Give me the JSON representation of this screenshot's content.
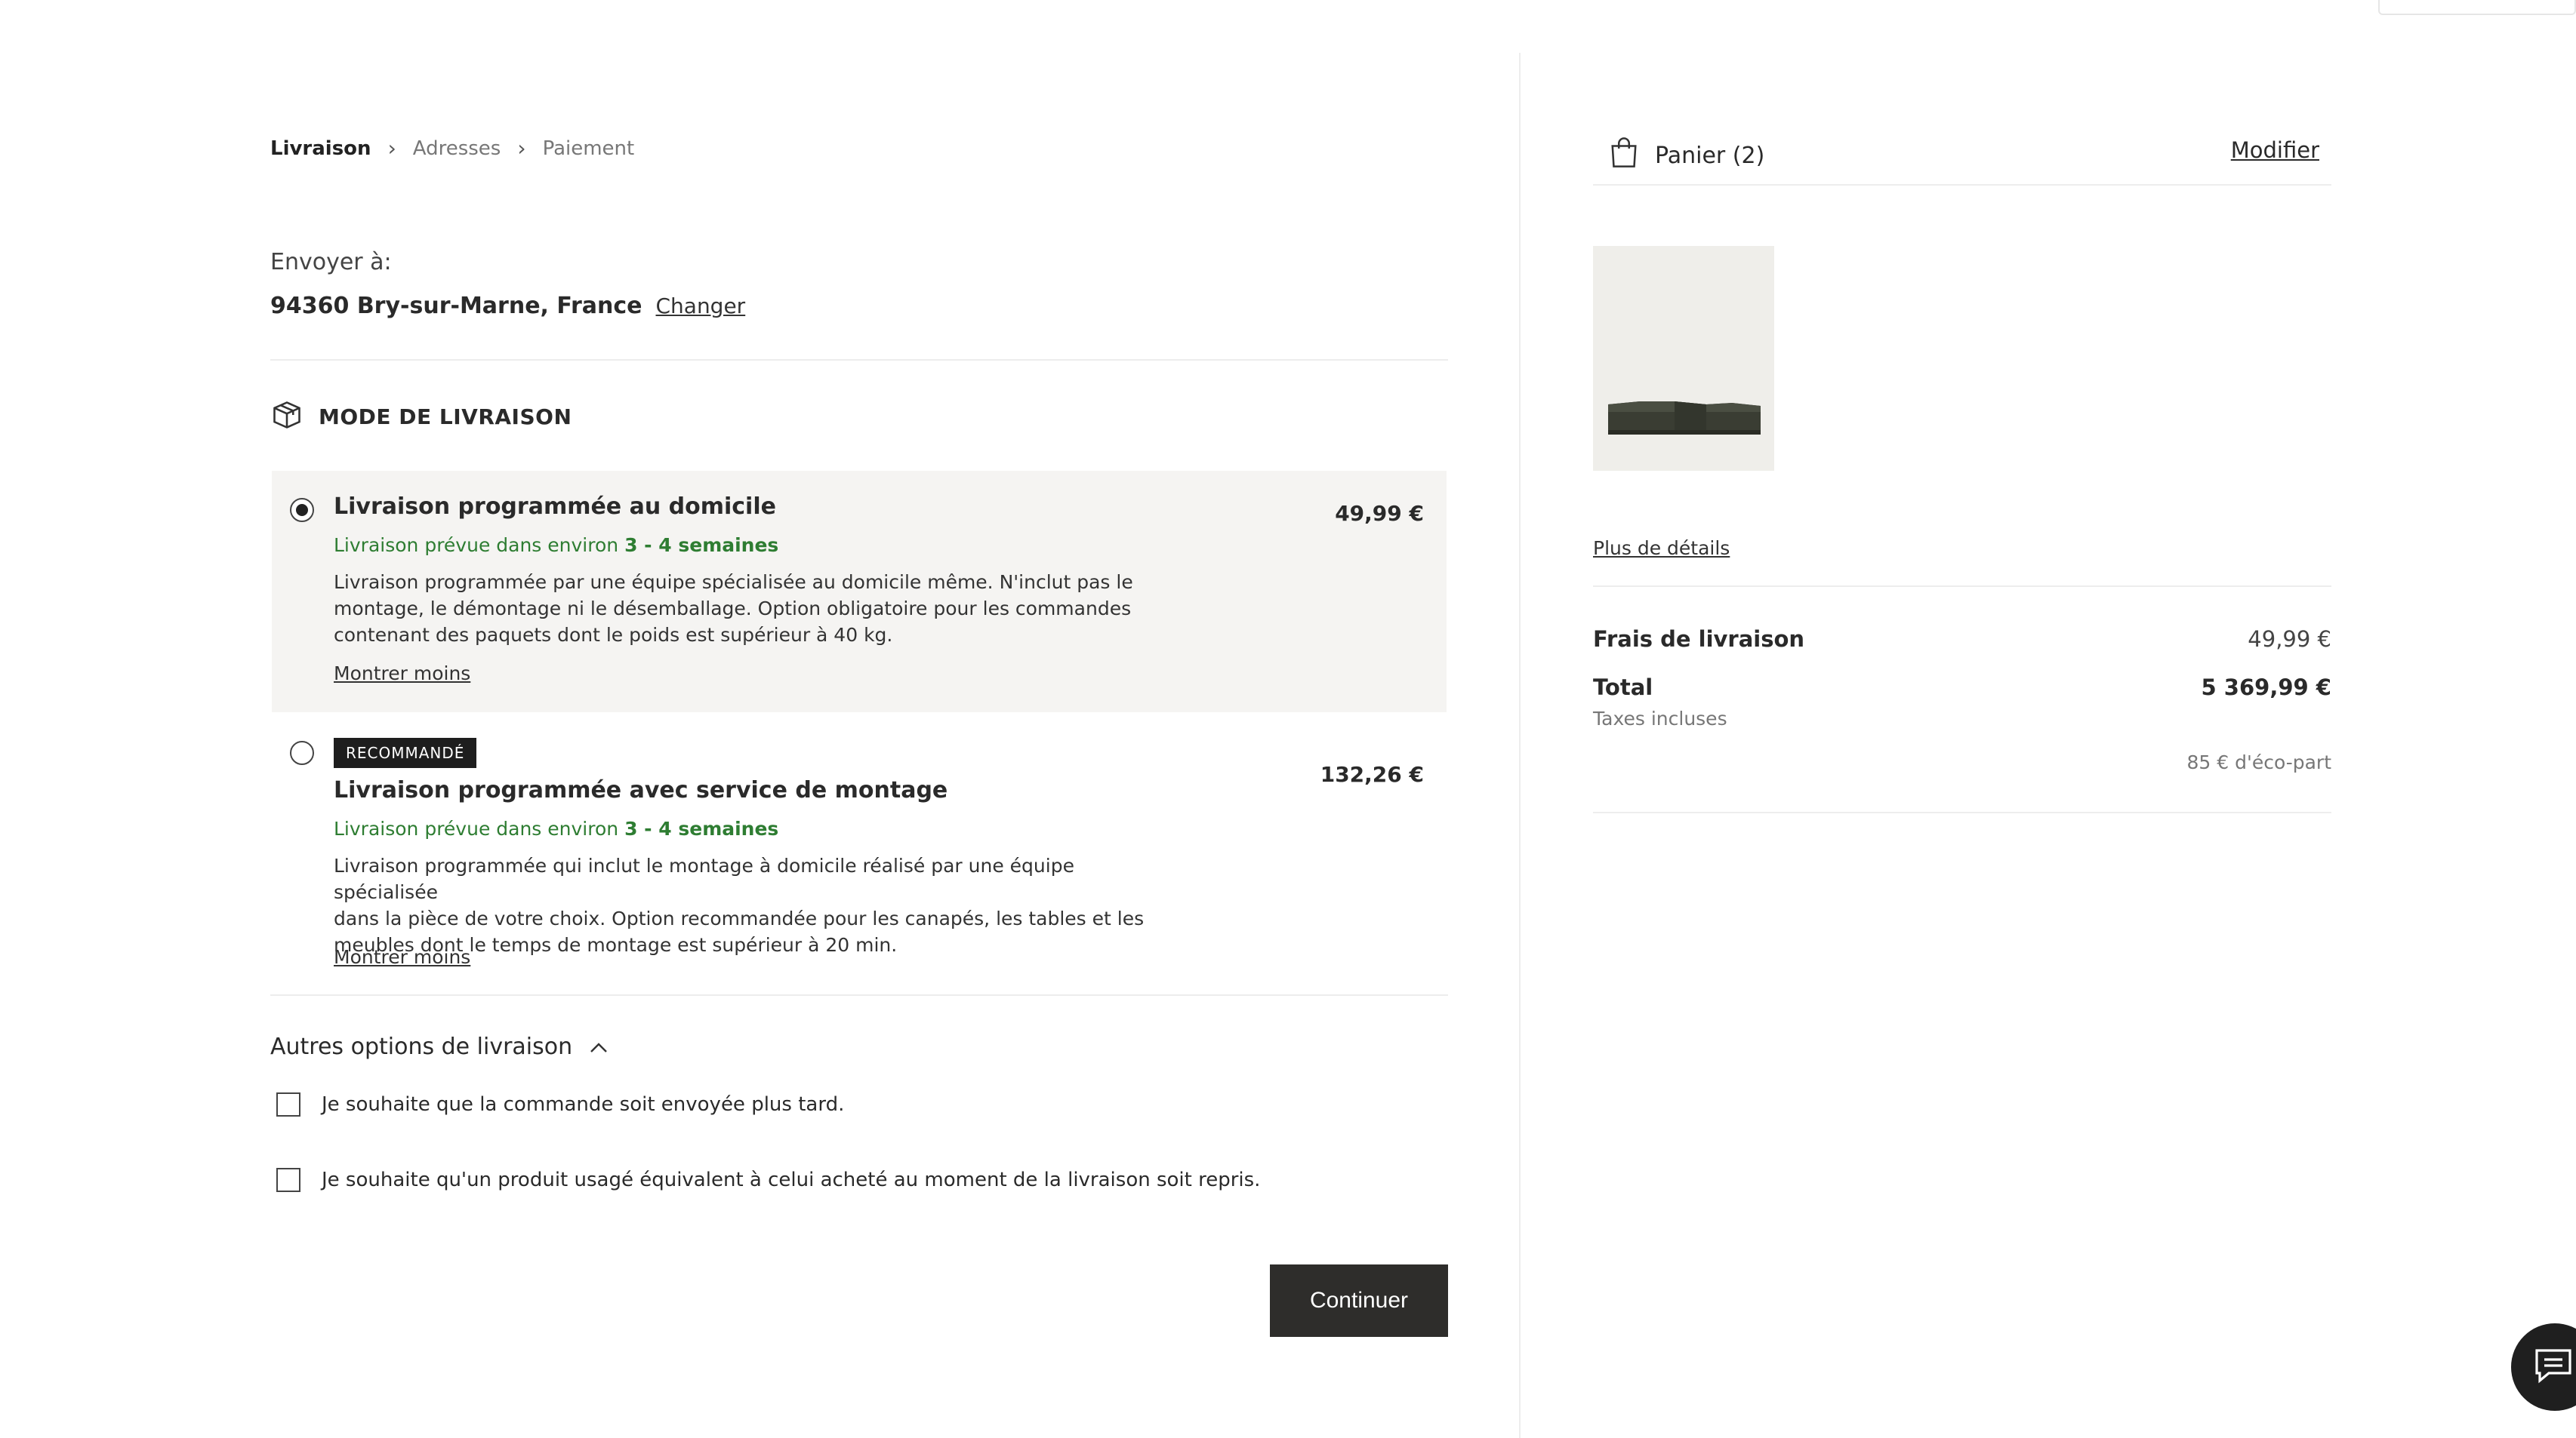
{
  "breadcrumb": {
    "steps": [
      "Livraison",
      "Adresses",
      "Paiement"
    ]
  },
  "shipping": {
    "label": "Envoyer à:",
    "address": "94360 Bry-sur-Marne, France",
    "change_label": "Changer"
  },
  "delivery_mode": {
    "title": "MODE DE LIVRAISON",
    "options": [
      {
        "title": "Livraison programmée au domicile",
        "eta_prefix": "Livraison prévue dans environ",
        "eta_value": "3 - 4 semaines",
        "desc_lines": [
          "Livraison programmée par une équipe spécialisée au domicile même. N'inclut pas le",
          "montage, le démontage ni le désemballage. Option obligatoire pour les commandes",
          "contenant des paquets dont le poids est supérieur à 40 kg."
        ],
        "toggle_label": "Montrer moins",
        "price": "49,99 €",
        "selected": true
      },
      {
        "badge": "RECOMMANDÉ",
        "title": "Livraison programmée avec service de montage",
        "eta_prefix": "Livraison prévue dans environ",
        "eta_value": "3 - 4 semaines",
        "desc_lines": [
          "Livraison programmée qui inclut le montage à domicile réalisé par une équipe spécialisée",
          "dans la pièce de votre choix. Option recommandée pour les canapés, les tables et les",
          "meubles dont le temps de montage est supérieur à 20 min."
        ],
        "toggle_label": "Montrer moins",
        "price": "132,26 €",
        "selected": false
      }
    ]
  },
  "other_options": {
    "title": "Autres options de livraison",
    "checkboxes": [
      "Je souhaite que la commande soit envoyée plus tard.",
      "Je souhaite qu'un produit usagé équivalent à celui acheté au moment de la livraison soit repris."
    ]
  },
  "continue_label": "Continuer",
  "cart": {
    "title": "Panier (2)",
    "modify_label": "Modifier",
    "details_label": "Plus de détails",
    "shipping_label": "Frais de livraison",
    "shipping_value": "49,99 €",
    "total_label": "Total",
    "total_value": "5 369,99 €",
    "taxes_label": "Taxes incluses",
    "eco_label": "85 € d'éco-part"
  },
  "colors": {
    "accent_green": "#2e7d32",
    "button_dark": "#2e2d2b",
    "selected_bg": "#f5f4f2"
  }
}
